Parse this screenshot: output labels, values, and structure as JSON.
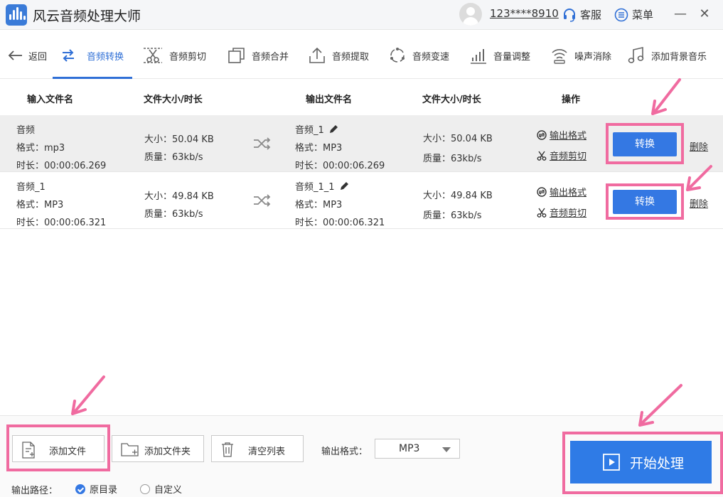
{
  "window": {
    "app_title": "风云音频处理大师",
    "user_phone": "123****8910",
    "service_label": "客服",
    "menu_label": "菜单",
    "minimize_glyph": "—",
    "close_glyph": "✕"
  },
  "toolbar": {
    "back_label": "返回",
    "items": [
      {
        "label": "音频转换",
        "icon": "convert-icon",
        "active": true
      },
      {
        "label": "音频剪切",
        "icon": "scissors-icon"
      },
      {
        "label": "音频合并",
        "icon": "merge-icon"
      },
      {
        "label": "音频提取",
        "icon": "upload-icon"
      },
      {
        "label": "音频变速",
        "icon": "speed-icon"
      },
      {
        "label": "音量调整",
        "icon": "volume-bars-icon"
      },
      {
        "label": "噪声消除",
        "icon": "noise-icon"
      },
      {
        "label": "添加背景音乐",
        "icon": "music-note-icon"
      }
    ]
  },
  "table": {
    "headers": {
      "input_name": "输入文件名",
      "input_size": "文件大小/时长",
      "output_name": "输出文件名",
      "output_size": "文件大小/时长",
      "actions": "操作"
    },
    "rows": [
      {
        "input_name": "音频",
        "input_format": "格式：mp3",
        "input_duration": "时长：00:00:06.269",
        "input_size": "大小：50.04 KB",
        "input_quality": "质量：63kb/s",
        "output_name": "音频_1",
        "output_format": "格式：MP3",
        "output_duration": "时长：00:00:06.269",
        "output_size": "大小：50.04 KB",
        "output_quality": "质量：63kb/s",
        "link_format": "输出格式",
        "link_cut": "音频剪切",
        "convert_label": "转换",
        "delete_label": "删除",
        "selected": true
      },
      {
        "input_name": "音频_1",
        "input_format": "格式：MP3",
        "input_duration": "时长：00:00:06.321",
        "input_size": "大小：49.84 KB",
        "input_quality": "质量：63kb/s",
        "output_name": "音频_1_1",
        "output_format": "格式：MP3",
        "output_duration": "时长：00:00:06.321",
        "output_size": "大小：49.84 KB",
        "output_quality": "质量：63kb/s",
        "link_format": "输出格式",
        "link_cut": "音频剪切",
        "convert_label": "转换",
        "delete_label": "删除",
        "selected": false
      }
    ]
  },
  "bottom": {
    "add_file_label": "添加文件",
    "add_folder_label": "添加文件夹",
    "clear_list_label": "清空列表",
    "output_format_label": "输出格式：",
    "output_format_value": "MP3",
    "output_path_label": "输出路径：",
    "path_option_original": "原目录",
    "path_option_custom": "自定义",
    "path_selected": "原目录",
    "start_label": "开始处理"
  },
  "colors": {
    "accent": "#3478e3",
    "highlight_annotation": "#f06ba0"
  }
}
